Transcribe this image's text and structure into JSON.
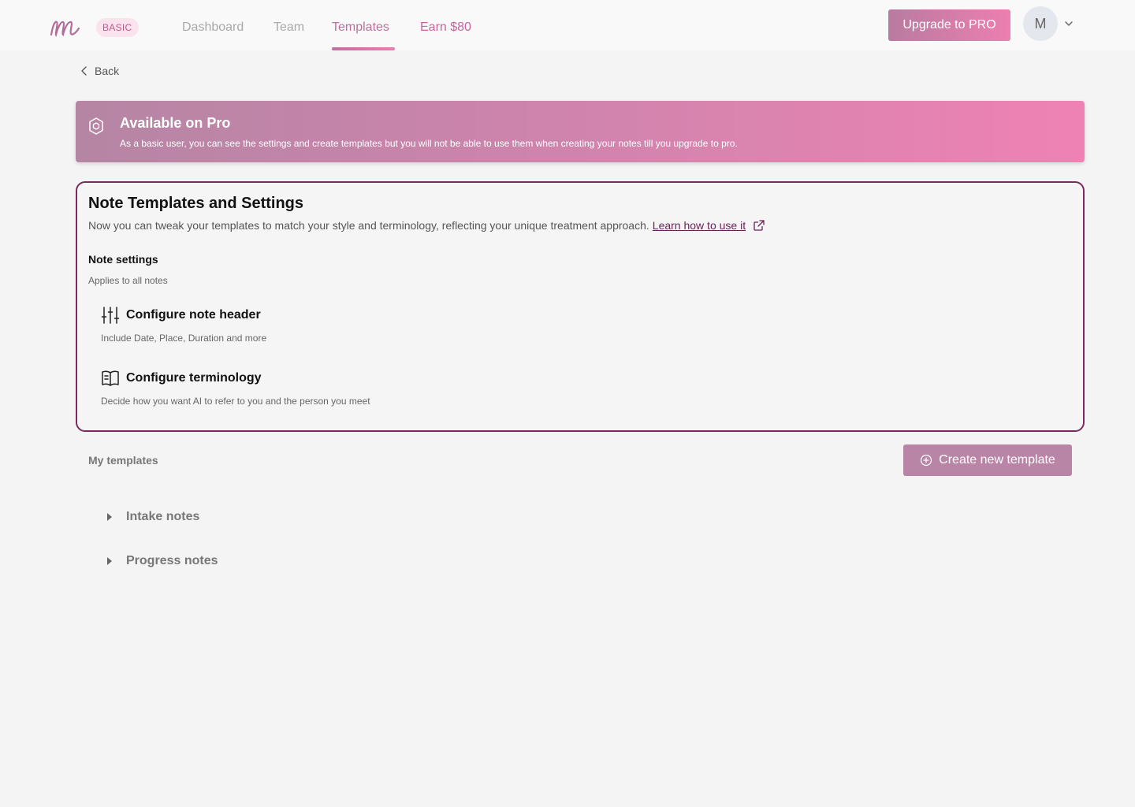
{
  "brand": {
    "logo_alt": "m",
    "plan_badge": "BASIC"
  },
  "nav": {
    "tabs": [
      {
        "label": "Dashboard",
        "active": false
      },
      {
        "label": "Team",
        "active": false
      },
      {
        "label": "Templates",
        "active": true
      },
      {
        "label": "Earn $80",
        "active": false
      }
    ]
  },
  "header": {
    "upgrade_label": "Upgrade to PRO",
    "avatar_initial": "M"
  },
  "back_label": "Back",
  "pro_banner": {
    "title": "Available on Pro",
    "text": "As a basic user, you can see the settings and create templates but you will not be able to use them when creating your notes till you upgrade to pro."
  },
  "settings": {
    "title": "Note Templates and Settings",
    "description": "Now you can tweak your templates to match your style and terminology, reflecting your unique treatment approach.",
    "learn_link": "Learn how to use it",
    "section_label": "Note settings",
    "section_sub": "Applies to all notes",
    "items": [
      {
        "label": "Configure note header",
        "sub": "Include Date, Place, Duration and more",
        "icon": "sliders-icon"
      },
      {
        "label": "Configure terminology",
        "sub": "Decide how you want AI to refer to you and the person you meet",
        "icon": "book-icon"
      }
    ]
  },
  "templates": {
    "title": "My templates",
    "create_label": "Create new template",
    "groups": [
      {
        "label": "Intake notes"
      },
      {
        "label": "Progress notes"
      }
    ]
  },
  "colors": {
    "accent": "#b985a6",
    "accent_pink": "#ec7fb0",
    "card_border": "#7a2a60",
    "link": "#6b1f55"
  }
}
